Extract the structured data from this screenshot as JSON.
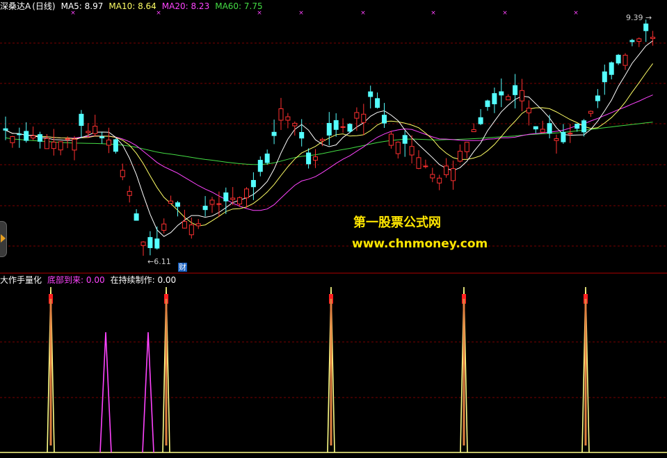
{
  "header": {
    "stock_name": "深桑达A",
    "period": "(日线)",
    "indicators": [
      {
        "label": "MA5: 8.97",
        "color": "#ffffff"
      },
      {
        "label": "MA10: 8.64",
        "color": "#ffff66"
      },
      {
        "label": "MA20: 8.23",
        "color": "#ff44ff"
      },
      {
        "label": "MA60: 7.75",
        "color": "#44dd44"
      }
    ]
  },
  "sub_header": {
    "title": "大作手量化",
    "items": [
      {
        "label": "底部到来: 0.00",
        "color": "#ff44ff"
      },
      {
        "label": "在持续制作: 0.00",
        "color": "#ffffff"
      }
    ]
  },
  "annotations": {
    "high_label": "9.39",
    "low_label": "6.11",
    "finance_badge": "财"
  },
  "watermark": {
    "title": "第一股票公式网",
    "url": "www.chnmoney.com"
  },
  "colors": {
    "up": "#ff3030",
    "down": "#54ffff",
    "ma5": "#ffffff",
    "ma10": "#ffff66",
    "ma20": "#ff44ff",
    "ma60": "#44dd44",
    "grid": "#7a0000",
    "signal_spike": "#ffff88",
    "signal_top": "#ff2020",
    "bottom_spike": "#ff44ff"
  },
  "chart_data": [
    {
      "type": "candlestick",
      "title": "深桑达A (日线)",
      "y_range": [
        5.9,
        9.7
      ],
      "high": 9.39,
      "low": 6.11,
      "series": [
        {
          "name": "MA5",
          "last": 8.97
        },
        {
          "name": "MA10",
          "last": 8.64
        },
        {
          "name": "MA20",
          "last": 8.23
        },
        {
          "name": "MA60",
          "last": 7.75
        }
      ]
    },
    {
      "type": "line",
      "title": "大作手量化",
      "series": [
        {
          "name": "底部到来",
          "last": 0.0
        },
        {
          "name": "在持续制作",
          "last": 0.0
        }
      ]
    }
  ]
}
